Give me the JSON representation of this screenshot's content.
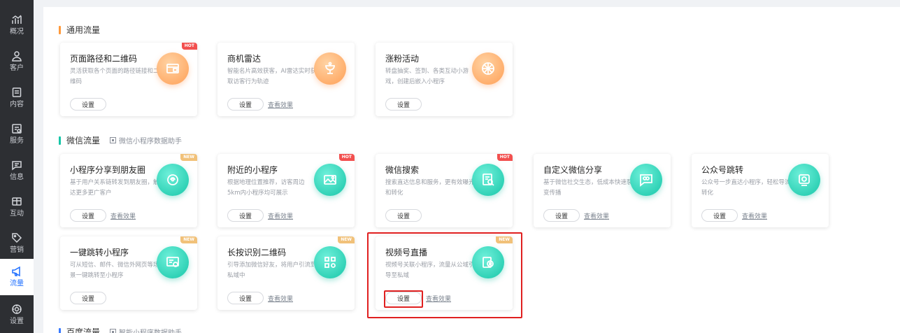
{
  "sidebar": {
    "items": [
      {
        "label": "概况",
        "icon": "chart-icon"
      },
      {
        "label": "客户",
        "icon": "user-icon"
      },
      {
        "label": "内容",
        "icon": "document-icon"
      },
      {
        "label": "服务",
        "icon": "service-icon"
      },
      {
        "label": "信息",
        "icon": "message-icon"
      },
      {
        "label": "互动",
        "icon": "interact-icon"
      },
      {
        "label": "营销",
        "icon": "tag-icon"
      },
      {
        "label": "流量",
        "icon": "megaphone-icon"
      },
      {
        "label": "设置",
        "icon": "gear-icon"
      }
    ],
    "active_index": 7
  },
  "sections": [
    {
      "title": "通用流量",
      "bar_color": "#ff9a3c"
    },
    {
      "title": "微信流量",
      "bar_color": "#17c6a8",
      "helper": "微信小程序数据助手"
    },
    {
      "title": "百度流量",
      "bar_color": "#3a7bff",
      "helper": "智能小程序数据助手"
    }
  ],
  "cards": [
    {
      "title": "页面路径和二维码",
      "desc": "灵活获取各个页面的路径链接和二维码",
      "tag": "HOT",
      "setup": "设置",
      "link": ""
    },
    {
      "title": "商机雷达",
      "desc": "智能名片高效获客，AI雷达实时获取访客行为轨迹",
      "tag": "",
      "setup": "设置",
      "link": "查看效果"
    },
    {
      "title": "涨粉活动",
      "desc": "转盘抽奖、签到、各类互动小游戏，创建后嵌入小程序",
      "tag": "",
      "setup": "设置",
      "link": ""
    },
    {
      "title": "小程序分享到朋友圈",
      "desc": "基于用户关系链转发到朋友圈，触达更多更广客户",
      "tag": "NEW",
      "setup": "设置",
      "link": "查看效果"
    },
    {
      "title": "附近的小程序",
      "desc": "根据地理位置推荐，访客周边5km内小程序均可展示",
      "tag": "HOT",
      "setup": "设置",
      "link": "查看效果"
    },
    {
      "title": "微信搜索",
      "desc": "搜索直达信息和服务，更有效曝光和转化",
      "tag": "HOT",
      "setup": "设置",
      "link": ""
    },
    {
      "title": "自定义微信分享",
      "desc": "基于微信社交生态，低成本快速裂变传播",
      "tag": "",
      "setup": "设置",
      "link": "查看效果"
    },
    {
      "title": "公众号跳转",
      "desc": "公众号一步直达小程序，轻松导流转化",
      "tag": "",
      "setup": "设置",
      "link": "查看效果"
    },
    {
      "title": "一键跳转小程序",
      "desc": "可从短信、邮件、微信外网页等场景一键跳转至小程序",
      "tag": "NEW",
      "setup": "设置",
      "link": ""
    },
    {
      "title": "长按识别二维码",
      "desc": "引导添加微信好友，将用户引流到私域中",
      "tag": "NEW",
      "setup": "设置",
      "link": "查看效果"
    },
    {
      "title": "视频号直播",
      "desc": "视频号关联小程序，流量从公域引导至私域",
      "tag": "NEW",
      "setup": "设置",
      "link": "查看效果"
    }
  ]
}
